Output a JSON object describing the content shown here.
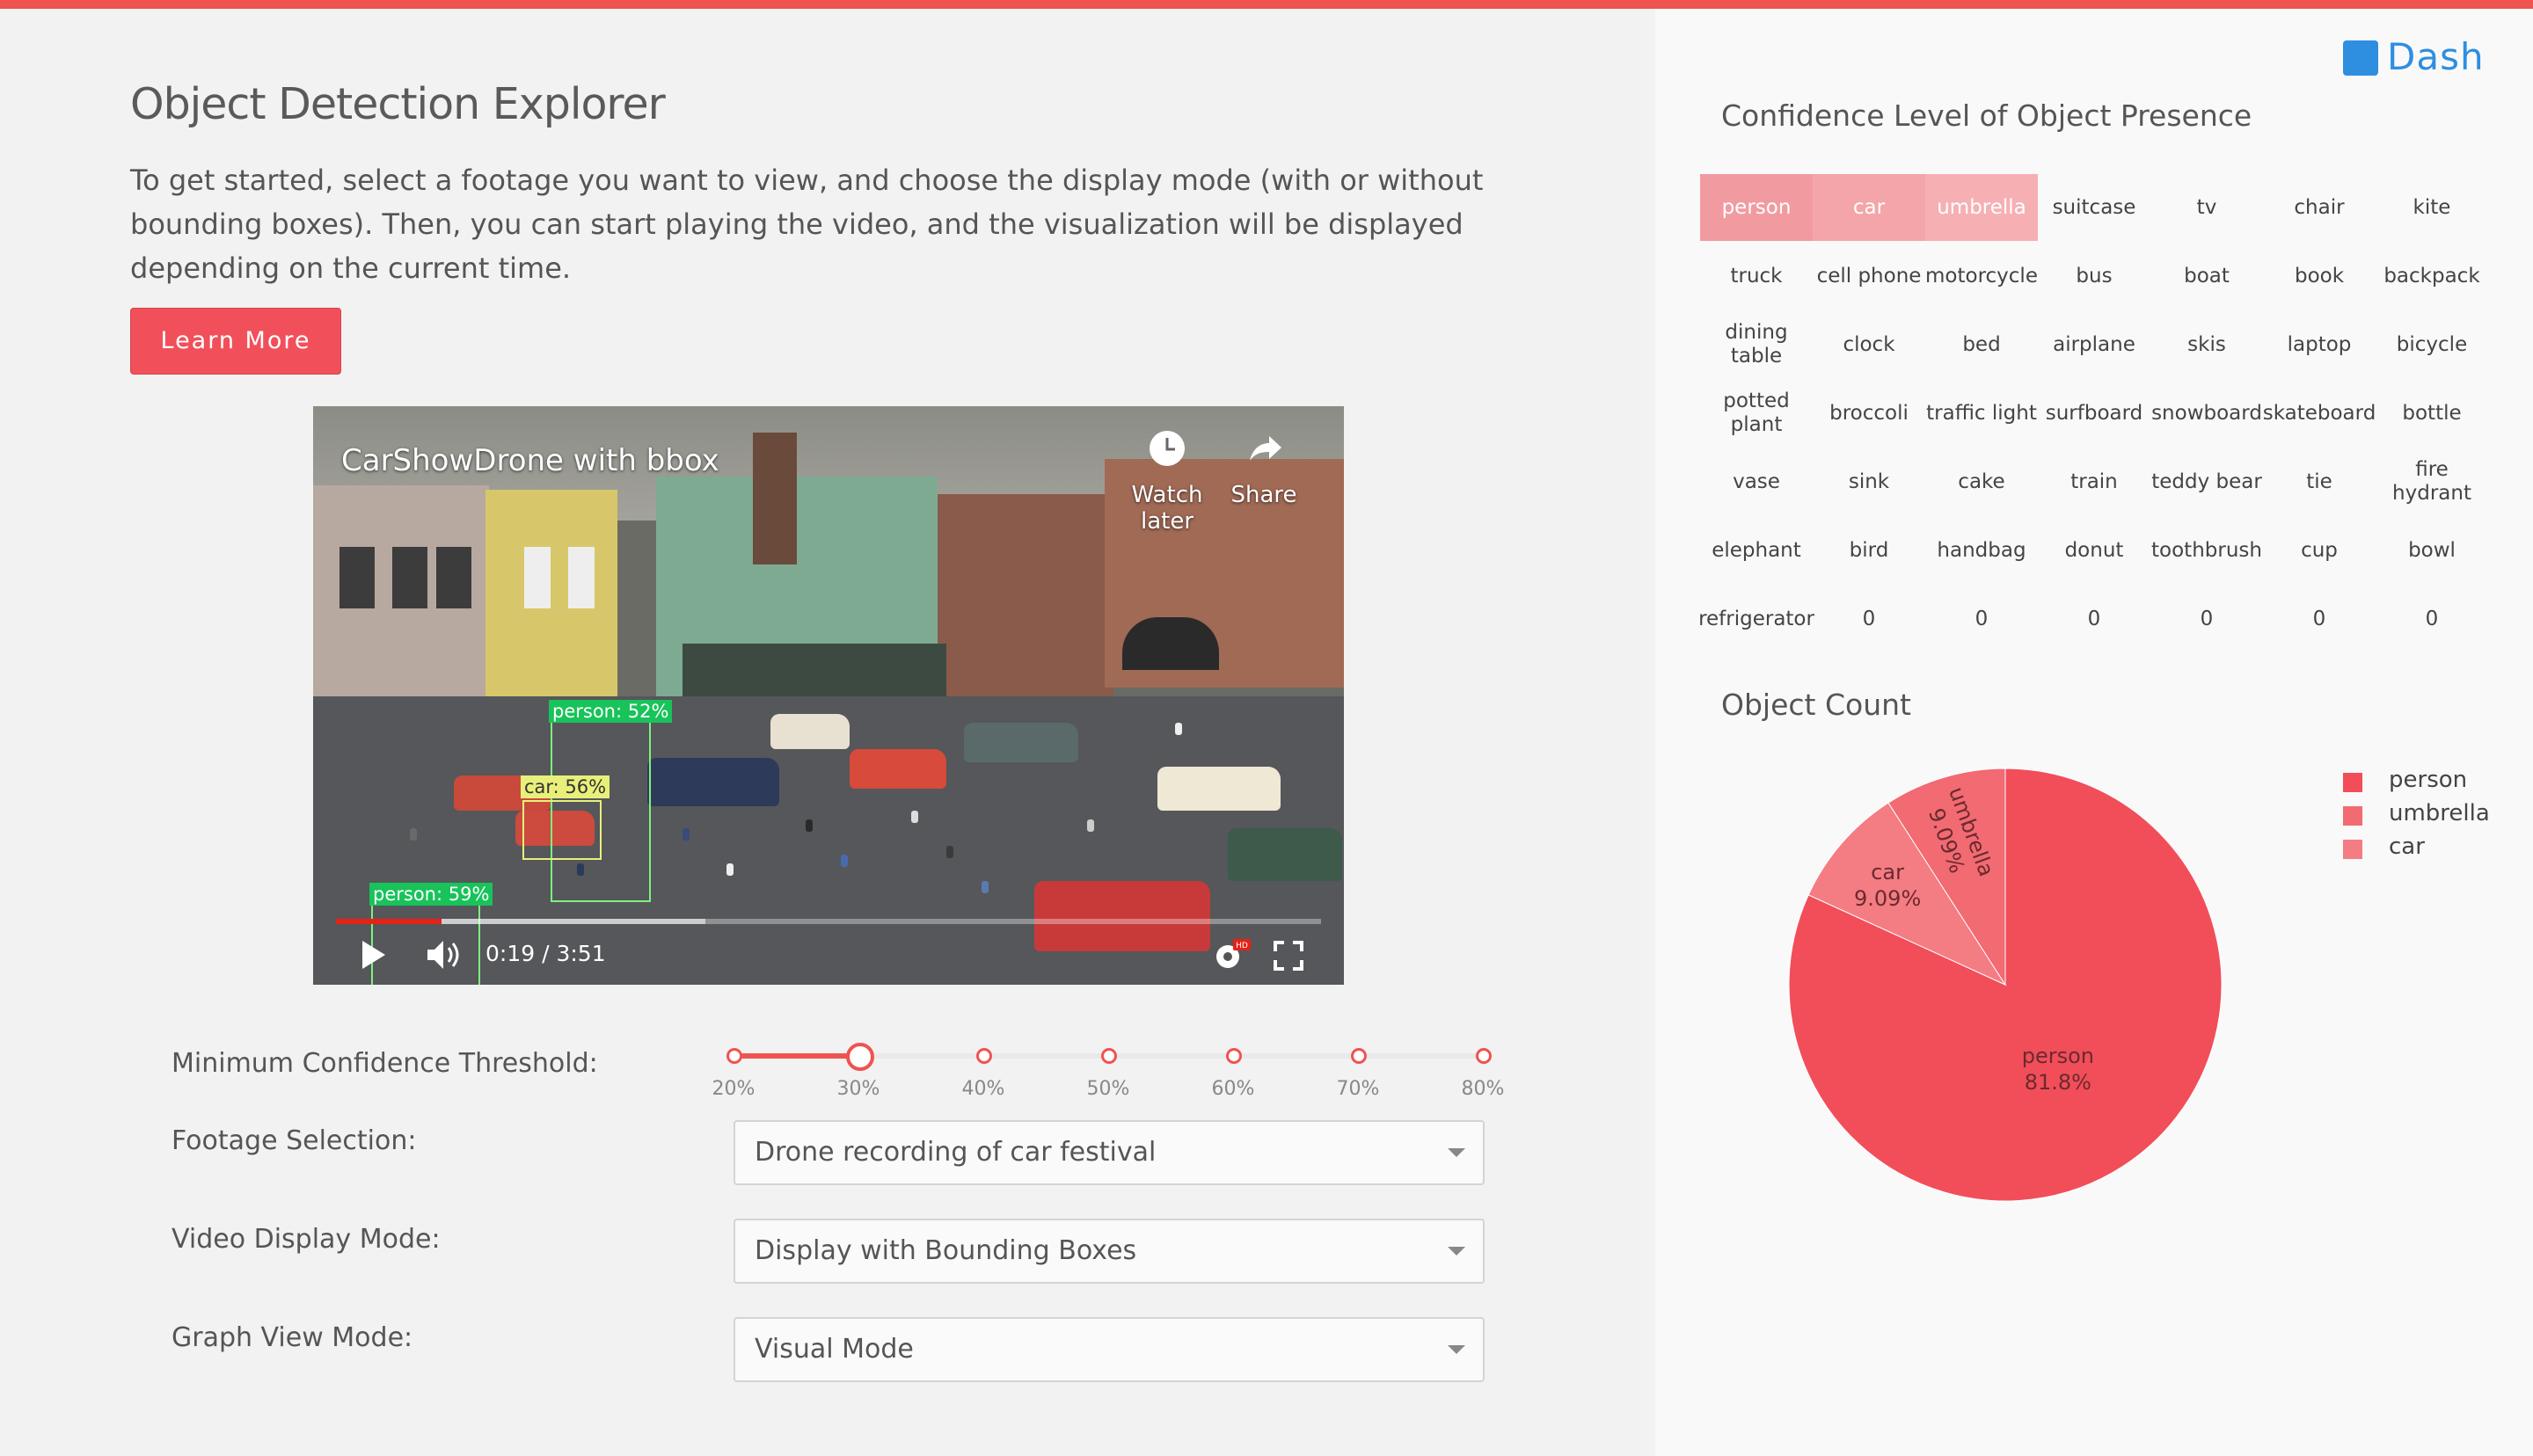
{
  "app": {
    "title": "Object Detection Explorer",
    "intro": "To get started, select a footage you want to view, and choose the display mode (with or without bounding boxes). Then, you can start playing the video, and the visualization will be displayed depending on the current time.",
    "learn_more": "Learn More",
    "accent_color": "#ef5350",
    "logo_text": "Dash",
    "logo_icon": "dash-logo-icon"
  },
  "video": {
    "title": "CarShowDrone with bbox",
    "watch_later": "Watch later",
    "share": "Share",
    "time": "0:19 / 3:51",
    "hd_badge": "HD",
    "progress": 0.082,
    "buffered": 0.29,
    "detections": [
      {
        "label": "person: 52%",
        "color": "green"
      },
      {
        "label": "car: 56%",
        "color": "yellow"
      },
      {
        "label": "person: 59%",
        "color": "green"
      }
    ]
  },
  "controls": {
    "threshold_label": "Minimum Confidence Threshold:",
    "threshold_ticks": [
      "20%",
      "30%",
      "40%",
      "50%",
      "60%",
      "70%",
      "80%"
    ],
    "threshold_value": "30%",
    "footage_label": "Footage Selection:",
    "footage_value": "Drone recording of car festival",
    "display_label": "Video Display Mode:",
    "display_value": "Display with Bounding Boxes",
    "graph_label": "Graph View Mode:",
    "graph_value": "Visual Mode"
  },
  "confidence": {
    "title": "Confidence Level of Object Presence",
    "rows": [
      [
        "person",
        "car",
        "umbrella",
        "suitcase",
        "tv",
        "chair",
        "kite"
      ],
      [
        "truck",
        "cell phone",
        "motorcycle",
        "bus",
        "boat",
        "book",
        "backpack"
      ],
      [
        "dining table",
        "clock",
        "bed",
        "airplane",
        "skis",
        "laptop",
        "bicycle"
      ],
      [
        "potted plant",
        "broccoli",
        "traffic light",
        "surfboard",
        "snowboard",
        "skateboard",
        "bottle"
      ],
      [
        "vase",
        "sink",
        "cake",
        "train",
        "teddy bear",
        "tie",
        "fire hydrant"
      ],
      [
        "elephant",
        "bird",
        "handbag",
        "donut",
        "toothbrush",
        "cup",
        "bowl"
      ],
      [
        "refrigerator",
        "0",
        "0",
        "0",
        "0",
        "0",
        "0"
      ]
    ],
    "highlighted": {
      "person": "#f19ba0",
      "car": "#f4a5a9",
      "umbrella": "#f6b0b4"
    }
  },
  "count": {
    "title": "Object Count"
  },
  "chart_data": {
    "type": "pie",
    "title": "Object Count",
    "slices": [
      {
        "label": "person",
        "value": 81.8,
        "display": "81.8%",
        "color": "#f14e5a"
      },
      {
        "label": "umbrella",
        "value": 9.09,
        "display": "9.09%",
        "color": "#f26a72"
      },
      {
        "label": "car",
        "value": 9.09,
        "display": "9.09%",
        "color": "#f47c83"
      }
    ],
    "legend": [
      "person",
      "umbrella",
      "car"
    ],
    "legend_position": "top-right"
  }
}
